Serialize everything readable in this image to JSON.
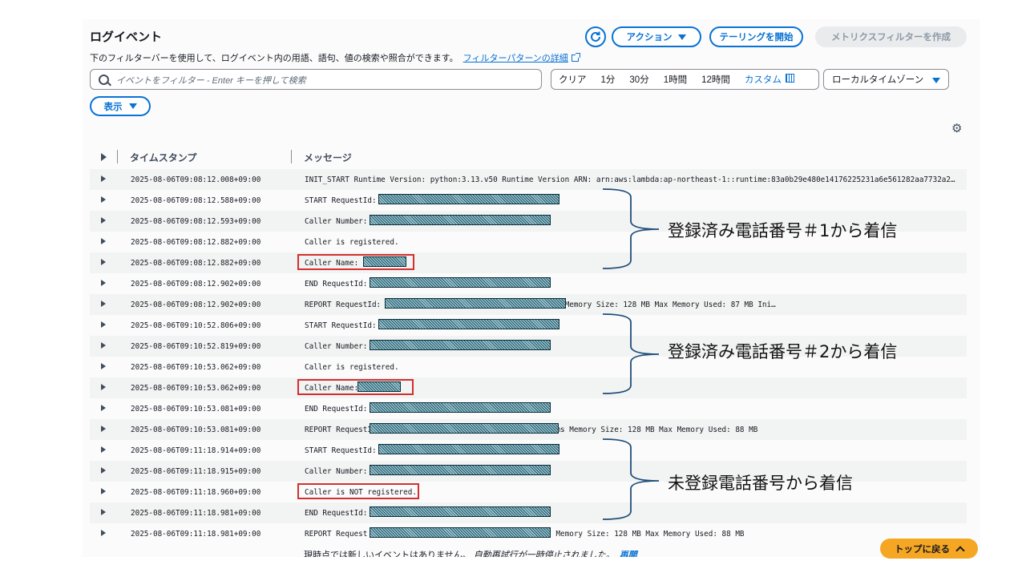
{
  "header": {
    "title": "ログイベント",
    "description": "下のフィルターバーを使用して、ログイベント内の用語、語句、値の検索や照合ができます。",
    "link": "フィルターパターンの詳細",
    "actions_label": "アクション",
    "tailing_label": "テーリングを開始",
    "metric_filter_label": "メトリクスフィルターを作成"
  },
  "filter": {
    "search_placeholder": "イベントをフィルター - Enter キーを押して検索",
    "time_ranges": [
      "クリア",
      "1分",
      "30分",
      "1時間",
      "12時間"
    ],
    "custom_label": "カスタム",
    "timezone": "ローカルタイムゾーン",
    "display_label": "表示"
  },
  "table": {
    "col_timestamp": "タイムスタンプ",
    "col_message": "メッセージ",
    "rows": [
      {
        "ts": "2025-08-06T09:08:12.008+09:00",
        "msg": "INIT_START Runtime Version: python:3.13.v50 Runtime Version ARN: arn:aws:lambda:ap-northeast-1::runtime:83a0b29e480e14176225231a6e561282aa7732a24…"
      },
      {
        "ts": "2025-08-06T09:08:12.588+09:00",
        "msg": "START RequestId:                                ion: $LATEST"
      },
      {
        "ts": "2025-08-06T09:08:12.593+09:00",
        "msg": "Caller Number:"
      },
      {
        "ts": "2025-08-06T09:08:12.882+09:00",
        "msg": "Caller is registered."
      },
      {
        "ts": "2025-08-06T09:08:12.882+09:00",
        "msg": "Caller Name:"
      },
      {
        "ts": "2025-08-06T09:08:12.902+09:00",
        "msg": "END RequestId:"
      },
      {
        "ts": "2025-08-06T09:08:12.902+09:00",
        "msg": "REPORT RequestId:                                tion: 312.90 ms Billed Duration: 313 ms Memory Size: 128 MB Max Memory Used: 87 MB Ini…"
      },
      {
        "ts": "2025-08-06T09:10:52.806+09:00",
        "msg": "START RequestId:                                ion: $LATEST"
      },
      {
        "ts": "2025-08-06T09:10:52.819+09:00",
        "msg": "Caller Number:"
      },
      {
        "ts": "2025-08-06T09:10:53.062+09:00",
        "msg": "Caller is registered."
      },
      {
        "ts": "2025-08-06T09:10:53.062+09:00",
        "msg": "Caller Name:"
      },
      {
        "ts": "2025-08-06T09:10:53.081+09:00",
        "msg": "END RequestId:"
      },
      {
        "ts": "2025-08-06T09:10:53.081+09:00",
        "msg": "REPORT RequestId:                                ation: 274.49 ms Billed Duration: 275 ms Memory Size: 128 MB Max Memory Used: 88 MB"
      },
      {
        "ts": "2025-08-06T09:11:18.914+09:00",
        "msg": "START RequestId:                                ion: $LATEST"
      },
      {
        "ts": "2025-08-06T09:11:18.915+09:00",
        "msg": "Caller Number:"
      },
      {
        "ts": "2025-08-06T09:11:18.960+09:00",
        "msg": "Caller is NOT registered."
      },
      {
        "ts": "2025-08-06T09:11:18.981+09:00",
        "msg": "END RequestId:"
      },
      {
        "ts": "2025-08-06T09:11:18.981+09:00",
        "msg": "REPORT Request                                 uration: 66.62 ms Billed Duration: 67 ms Memory Size: 128 MB Max Memory Used: 88 MB"
      }
    ]
  },
  "footer": {
    "status": "現時点では新しいイベントはありません。",
    "paused": "自動再試行が一時停止されました。",
    "resume": "再開"
  },
  "back_to_top": "トップに戻る",
  "annotations": {
    "group1": "登録済み電話番号＃1から着信",
    "group2": "登録済み電話番号＃2から着信",
    "group3": "未登録電話番号から着信"
  },
  "colors": {
    "accent": "#0972d3",
    "highlight": "#d32f2f",
    "back_to_top": "#f5a623"
  }
}
